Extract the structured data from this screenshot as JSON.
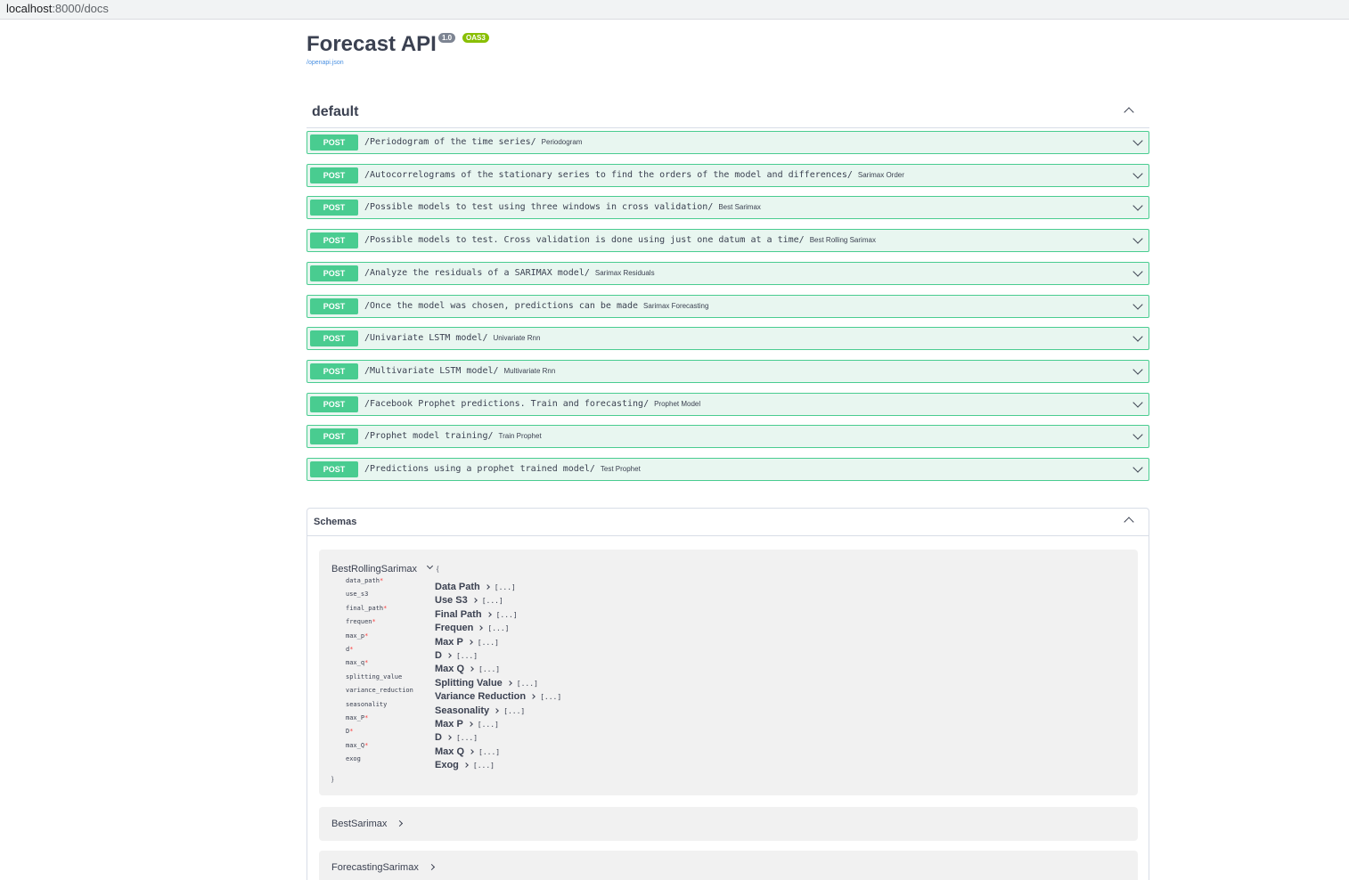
{
  "browser": {
    "url_host": "localhost",
    "url_path": ":8000/docs"
  },
  "info": {
    "title": "Forecast API",
    "version": "1.0",
    "oas": "OAS3",
    "spec_link": "/openapi.json"
  },
  "tag": {
    "name": "default"
  },
  "operations": [
    {
      "method": "POST",
      "path": "/Periodogram of the time series/",
      "summary": "Periodogram"
    },
    {
      "method": "POST",
      "path": "/Autocorrelograms of the stationary series to find the orders of the model and differences/",
      "summary": "Sarimax Order"
    },
    {
      "method": "POST",
      "path": "/Possible models to test using three windows in cross validation/",
      "summary": "Best Sarimax"
    },
    {
      "method": "POST",
      "path": "/Possible models to test. Cross validation is done using just one datum at a time/",
      "summary": "Best Rolling Sarimax"
    },
    {
      "method": "POST",
      "path": "/Analyze the residuals of a SARIMAX model/",
      "summary": "Sarimax Residuals"
    },
    {
      "method": "POST",
      "path": "/Once the model was chosen, predictions can be made",
      "summary": "Sarimax Forecasting"
    },
    {
      "method": "POST",
      "path": "/Univariate LSTM model/",
      "summary": "Univariate Rnn"
    },
    {
      "method": "POST",
      "path": "/Multivariate LSTM model/",
      "summary": "Multivariate Rnn"
    },
    {
      "method": "POST",
      "path": "/Facebook Prophet predictions. Train and forecasting/",
      "summary": "Prophet Model"
    },
    {
      "method": "POST",
      "path": "/Prophet model training/",
      "summary": "Train Prophet"
    },
    {
      "method": "POST",
      "path": "/Predictions using a prophet trained model/",
      "summary": "Test Prophet"
    }
  ],
  "schemas": {
    "title": "Schemas",
    "expanded_model": {
      "name": "BestRollingSarimax",
      "brace_open": "{",
      "brace_close": "}",
      "ellipsis": "[...]",
      "properties": [
        {
          "name": "data_path",
          "required": "*",
          "title": "Data Path"
        },
        {
          "name": "use_s3",
          "required": "",
          "title": "Use S3"
        },
        {
          "name": "final_path",
          "required": "*",
          "title": "Final Path"
        },
        {
          "name": "frequen",
          "required": "*",
          "title": "Frequen"
        },
        {
          "name": "max_p",
          "required": "*",
          "title": "Max P"
        },
        {
          "name": "d",
          "required": "*",
          "title": "D"
        },
        {
          "name": "max_q",
          "required": "*",
          "title": "Max Q"
        },
        {
          "name": "splitting_value",
          "required": "",
          "title": "Splitting Value"
        },
        {
          "name": "variance_reduction",
          "required": "",
          "title": "Variance Reduction"
        },
        {
          "name": "seasonality",
          "required": "",
          "title": "Seasonality"
        },
        {
          "name": "max_P",
          "required": "*",
          "title": "Max P"
        },
        {
          "name": "D",
          "required": "*",
          "title": "D"
        },
        {
          "name": "max_Q",
          "required": "*",
          "title": "Max Q"
        },
        {
          "name": "exog",
          "required": "",
          "title": "Exog"
        }
      ]
    },
    "collapsed_models": [
      "BestSarimax",
      "ForecastingSarimax"
    ]
  }
}
